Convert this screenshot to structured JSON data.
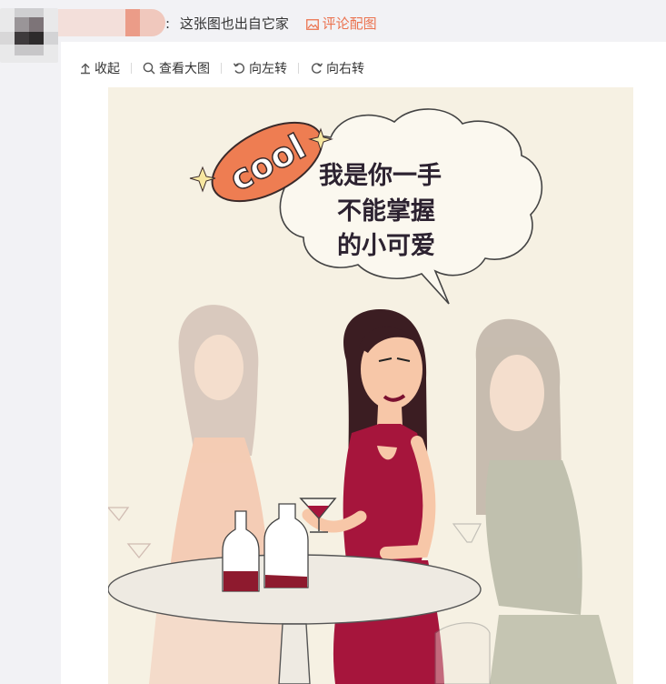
{
  "comment": {
    "separator": ":",
    "text": "这张图也出自它家",
    "photo_link_label": "评论配图"
  },
  "toolbar": {
    "collapse_label": "收起",
    "view_large_label": "查看大图",
    "rotate_left_label": "向左转",
    "rotate_right_label": "向右转"
  },
  "image": {
    "badge_text": "cool",
    "speech_lines": [
      "我是你一手",
      "不能掌握",
      "的小可爱"
    ]
  },
  "colors": {
    "link_orange": "#eb7350",
    "badge_orange": "#ee7d52",
    "dress_red": "#a6153c",
    "canvas_bg": "#f6f1e3"
  }
}
